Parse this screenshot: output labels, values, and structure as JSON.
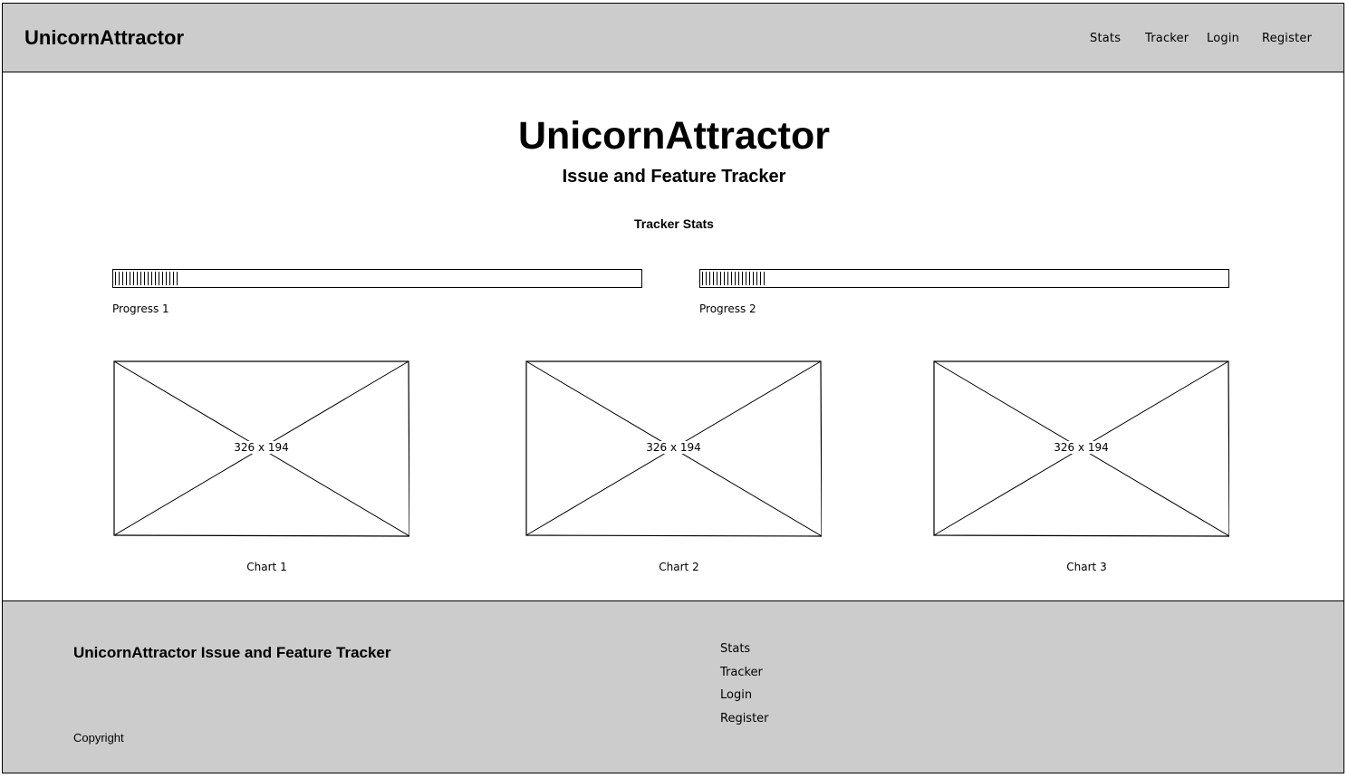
{
  "header": {
    "brand": "UnicornAttractor",
    "nav": [
      "Stats",
      "Tracker",
      "Login",
      "Register"
    ]
  },
  "hero": {
    "title": "UnicornAttractor",
    "subtitle": "Issue and Feature Tracker"
  },
  "stats": {
    "title": "Tracker Stats",
    "progress": [
      {
        "label": "Progress 1",
        "value": 0.12
      },
      {
        "label": "Progress 2",
        "value": 0.12
      }
    ],
    "charts": [
      {
        "caption": "Chart 1",
        "placeholder": "326 x 194"
      },
      {
        "caption": "Chart 2",
        "placeholder": "326 x 194"
      },
      {
        "caption": "Chart 3",
        "placeholder": "326 x 194"
      }
    ]
  },
  "footer": {
    "title": "UnicornAttractor Issue and Feature Tracker",
    "links": [
      "Stats",
      "Tracker",
      "Login",
      "Register"
    ],
    "copyright": "Copyright"
  },
  "colors": {
    "bar_background": "#cccccc",
    "page_background": "#ffffff",
    "ink": "#000000"
  }
}
